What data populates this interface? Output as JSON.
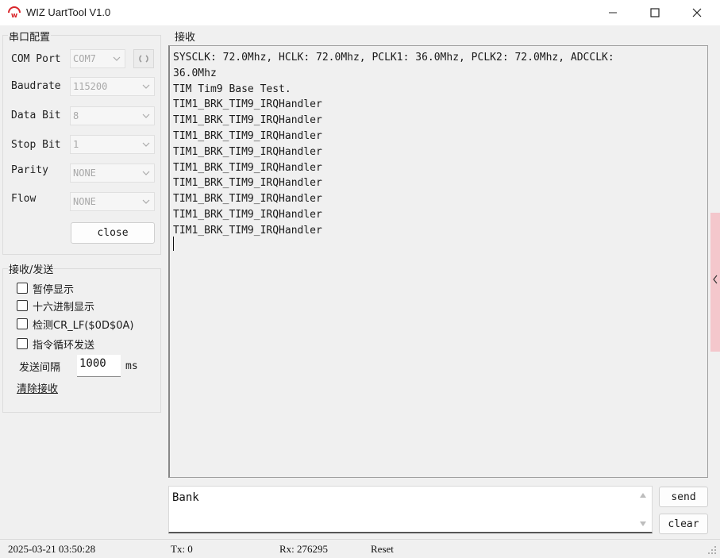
{
  "window": {
    "title": "WIZ UartTool V1.0"
  },
  "serial_config": {
    "group_label": "串口配置",
    "com_port": {
      "label": "COM Port",
      "value": "COM7"
    },
    "baudrate": {
      "label": "Baudrate",
      "value": "115200"
    },
    "data_bit": {
      "label": "Data Bit",
      "value": "8"
    },
    "stop_bit": {
      "label": "Stop Bit",
      "value": "1"
    },
    "parity": {
      "label": "Parity",
      "value": "NONE"
    },
    "flow": {
      "label": "Flow",
      "value": "NONE"
    },
    "close_label": "close"
  },
  "recv_send": {
    "group_label": "接收/发送",
    "options": [
      {
        "label": "暂停显示",
        "checked": false
      },
      {
        "label": "十六进制显示",
        "checked": false
      },
      {
        "label": "检测CR_LF($0D$0A)",
        "checked": false
      },
      {
        "label": "指令循环发送",
        "checked": false
      }
    ],
    "interval_label": "发送间隔",
    "interval_value": "1000",
    "interval_unit": "ms",
    "clear_recv_label": "清除接收"
  },
  "receive": {
    "label": "接收",
    "lines": [
      "SYSCLK: 72.0Mhz, HCLK: 72.0Mhz, PCLK1: 36.0Mhz, PCLK2: 72.0Mhz, ADCCLK:",
      "36.0Mhz",
      "TIM Tim9 Base Test.",
      "TIM1_BRK_TIM9_IRQHandler",
      "TIM1_BRK_TIM9_IRQHandler",
      "TIM1_BRK_TIM9_IRQHandler",
      "TIM1_BRK_TIM9_IRQHandler",
      "TIM1_BRK_TIM9_IRQHandler",
      "TIM1_BRK_TIM9_IRQHandler",
      "TIM1_BRK_TIM9_IRQHandler",
      "TIM1_BRK_TIM9_IRQHandler",
      "TIM1_BRK_TIM9_IRQHandler"
    ]
  },
  "send": {
    "text": "Bank",
    "send_label": "send",
    "clear_label": "clear"
  },
  "status": {
    "timestamp": "2025-03-21 03:50:28",
    "tx": "Tx: 0",
    "rx": "Rx: 276295",
    "reset": "Reset"
  },
  "colors": {
    "accent_handle": "#f4c7cc",
    "logo_red": "#d9262b"
  }
}
